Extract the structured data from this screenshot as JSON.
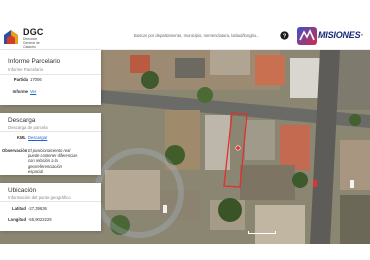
{
  "header": {
    "logo_title": "DGC",
    "logo_subtitle": "Dirección General de Catastro",
    "search_placeholder": "Buscar por departamento, municipio, nomenclatura, latitud/longitu...",
    "help_icon": "help-circle-icon",
    "brand_name": "MISIONES",
    "brand_suffix": "·"
  },
  "panels": {
    "informe": {
      "title": "Informe Parcelario",
      "subtitle": "Informe Parcelario",
      "partida_label": "Partida",
      "partida_value": "17006",
      "informe_label": "Informe",
      "informe_link": "Ver"
    },
    "descarga": {
      "title": "Descarga",
      "subtitle": "Descarga de parcela",
      "kml_label": "KML",
      "kml_link": "Descargar",
      "observacion_label": "Observación",
      "observacion_text": "El posicionamiento real puede contener diferencias con relación a la georreferenciación espacial"
    },
    "ubicacion": {
      "title": "Ubicación",
      "subtitle": "Información del punto geográfico",
      "latitud_label": "Latitud",
      "latitud_value": "-27,39636",
      "longitud_label": "Longitud",
      "longitud_value": "-55,9022229"
    }
  },
  "map": {
    "parcel_color": "#e0302f",
    "marker_icon": "location-pin-icon"
  },
  "colors": {
    "link": "#1d63d1",
    "brand_blue": "#1a2a7a",
    "brand_red": "#c9273f"
  }
}
